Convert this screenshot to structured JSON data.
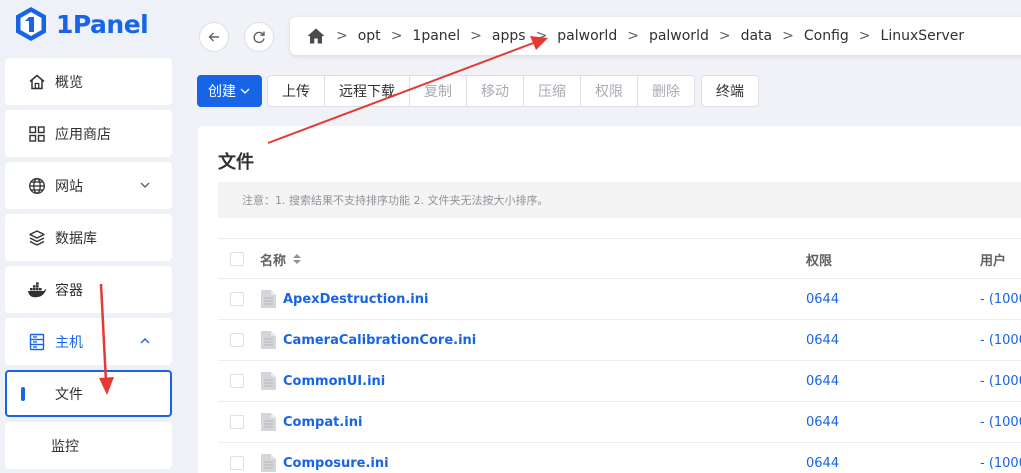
{
  "brand": {
    "name": "1Panel",
    "accent": "#1765e6",
    "annotation_color": "#e53935"
  },
  "sidebar": {
    "items": [
      {
        "label": "概览",
        "icon": "home-icon"
      },
      {
        "label": "应用商店",
        "icon": "apps-grid-icon"
      },
      {
        "label": "网站",
        "icon": "globe-icon",
        "expandable": true
      },
      {
        "label": "数据库",
        "icon": "database-icon"
      },
      {
        "label": "容器",
        "icon": "docker-icon"
      },
      {
        "label": "主机",
        "icon": "host-icon",
        "expanded": true
      },
      {
        "label": "文件",
        "active": true
      },
      {
        "label": "监控"
      }
    ]
  },
  "breadcrumb": {
    "items": [
      "opt",
      "1panel",
      "apps",
      "palworld",
      "palworld",
      "data",
      "Config",
      "LinuxServer"
    ]
  },
  "toolbar": {
    "create": "创建",
    "upload": "上传",
    "remote_download": "远程下载",
    "copy": "复制",
    "move": "移动",
    "compress": "压缩",
    "permission": "权限",
    "delete": "删除",
    "terminal": "终端"
  },
  "main": {
    "title": "文件",
    "notice": "注意：1. 搜索结果不支持排序功能 2. 文件夹无法按大小排序。",
    "columns": {
      "name": "名称",
      "permission": "权限",
      "user": "用户"
    },
    "rows": [
      {
        "name": "ApexDestruction.ini",
        "permission": "0644",
        "user": "- (1000"
      },
      {
        "name": "CameraCalibrationCore.ini",
        "permission": "0644",
        "user": "- (1000"
      },
      {
        "name": "CommonUI.ini",
        "permission": "0644",
        "user": "- (1000"
      },
      {
        "name": "Compat.ini",
        "permission": "0644",
        "user": "- (1000"
      },
      {
        "name": "Composure.ini",
        "permission": "0644",
        "user": "- (1000"
      }
    ]
  }
}
